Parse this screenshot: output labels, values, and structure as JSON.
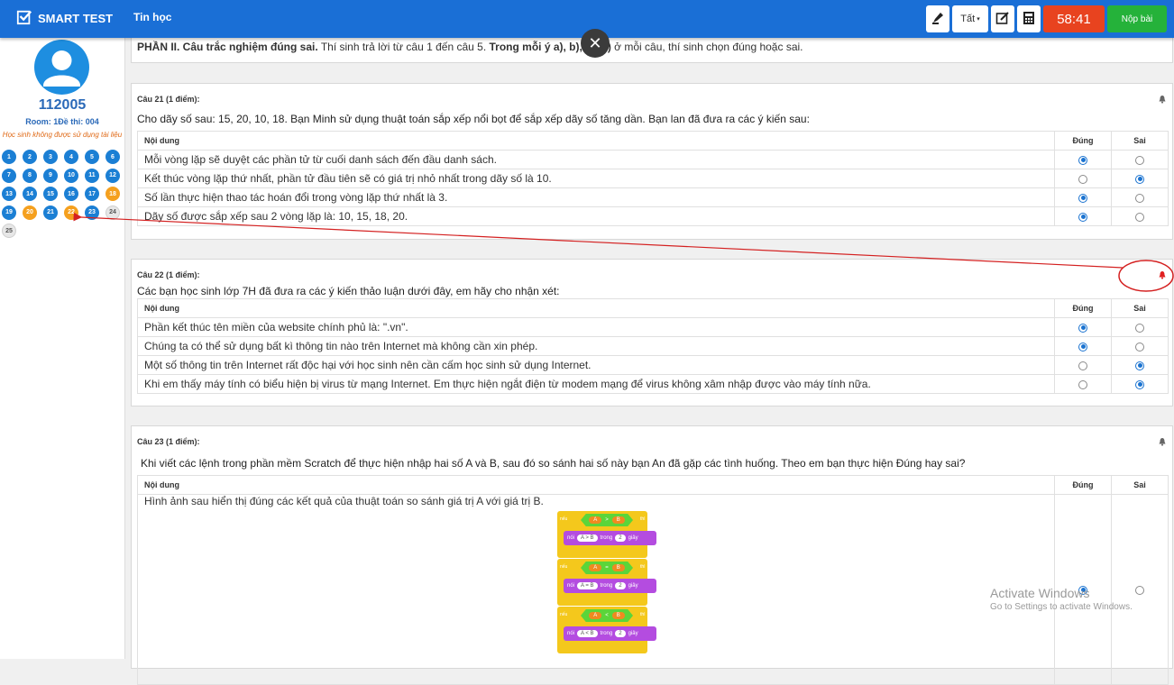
{
  "app": {
    "name": "SMART TEST",
    "subject": "Tin học"
  },
  "toolbar": {
    "filter_label": "Tất",
    "timer": "58:41",
    "submit_label": "Nộp bài"
  },
  "sidebar": {
    "student_id": "112005",
    "room": "Room: 1Đề thi: 004",
    "warning": "Học sinh không được sử dụng tài liệu",
    "questions": [
      {
        "n": "1",
        "s": "answered"
      },
      {
        "n": "2",
        "s": "answered"
      },
      {
        "n": "3",
        "s": "answered"
      },
      {
        "n": "4",
        "s": "answered"
      },
      {
        "n": "5",
        "s": "answered"
      },
      {
        "n": "6",
        "s": "answered"
      },
      {
        "n": "7",
        "s": "answered"
      },
      {
        "n": "8",
        "s": "answered"
      },
      {
        "n": "9",
        "s": "answered"
      },
      {
        "n": "10",
        "s": "answered"
      },
      {
        "n": "11",
        "s": "answered"
      },
      {
        "n": "12",
        "s": "answered"
      },
      {
        "n": "13",
        "s": "answered"
      },
      {
        "n": "14",
        "s": "answered"
      },
      {
        "n": "15",
        "s": "answered"
      },
      {
        "n": "16",
        "s": "answered"
      },
      {
        "n": "17",
        "s": "answered"
      },
      {
        "n": "18",
        "s": "flag"
      },
      {
        "n": "19",
        "s": "answered"
      },
      {
        "n": "20",
        "s": "flag"
      },
      {
        "n": "21",
        "s": "answered"
      },
      {
        "n": "22",
        "s": "flag"
      },
      {
        "n": "23",
        "s": "answered"
      },
      {
        "n": "24",
        "s": "empty"
      },
      {
        "n": "25",
        "s": "empty"
      }
    ]
  },
  "part": {
    "bold1": "PHẦN II. Câu trắc nghiệm đúng sai.",
    "text1": " Thí sinh trả lời từ câu 1 đến câu 5. ",
    "bold2": "Trong mỗi ý a), b), c), d)",
    "text2": " ở mỗi câu, thí sinh chọn đúng hoặc sai."
  },
  "headers": {
    "content": "Nội dung",
    "true": "Đúng",
    "false": "Sai"
  },
  "q21": {
    "title": "Câu 21 (1 điểm):",
    "text": "Cho dãy số sau: 15, 20, 10, 18. Bạn Minh sử dụng thuật toán sắp xếp nổi bọt để sắp xếp dãy số tăng dần. Bạn lan đã đưa ra các ý kiến sau:",
    "rows": [
      {
        "text": "Mỗi vòng lặp sẽ duyệt các phần tử từ cuối danh sách đến đầu danh sách.",
        "ans": "true"
      },
      {
        "text": "Kết thúc vòng lặp thứ nhất, phần tử đầu tiên sẽ có giá trị nhỏ nhất trong dãy số là 10.",
        "ans": "false"
      },
      {
        "text": "Số lần thực hiện thao tác hoán đổi trong vòng lặp thứ nhất là 3.",
        "ans": "true"
      },
      {
        "text": "Dãy số được sắp xếp sau 2 vòng lặp là: 10, 15, 18, 20.",
        "ans": "true"
      }
    ]
  },
  "q22": {
    "title": "Câu 22 (1 điểm):",
    "text": "Các bạn học sinh lớp 7H đã đưa ra các ý kiến thảo luận dưới đây, em hãy cho nhận xét:",
    "rows": [
      {
        "text": "Phần kết thúc tên miền của website chính phủ là: \".vn\".",
        "ans": "true"
      },
      {
        "text": "Chúng ta có thể sử dụng bất kì thông tin nào trên Internet mà không cần xin phép.",
        "ans": "true"
      },
      {
        "text": "Một số thông tin trên Internet rất độc hại với học sinh nên cần cấm học sinh sử dụng Internet.",
        "ans": "false"
      },
      {
        "text": "Khi em thấy máy tính có biểu hiện bị virus từ mạng Internet. Em thực hiện ngắt điện từ modem mạng để virus không xâm nhập được vào máy tính nữa.",
        "ans": "false"
      }
    ]
  },
  "q23": {
    "title": "Câu 23 (1 điểm):",
    "text": "Khi viết các lệnh trong phần mềm Scratch để thực hiện nhập hai số A và B, sau đó so sánh hai số này bạn An đã gặp các tình huống. Theo em bạn thực hiện Đúng hay sai?",
    "rows": [
      {
        "text": "Hình ảnh sau hiển thị đúng các kết quả của thuật toán so sánh giá trị A với giá trị B.",
        "ans": "true"
      }
    ],
    "blocks": {
      "if_label": "nếu",
      "then_label": "thì",
      "say_label": "nói",
      "for_label": "trong",
      "secs_label": "giây",
      "a": "A",
      "b": "B",
      "secs": "2",
      "items": [
        {
          "op": ">",
          "say": "A > B"
        },
        {
          "op": "=",
          "say": "A = B"
        },
        {
          "op": "<",
          "say": "A < B"
        }
      ]
    }
  },
  "watermark": {
    "line1": "Activate Windows",
    "line2": "Go to Settings to activate Windows."
  },
  "colors": {
    "topbar": "#1a6fd6",
    "timer": "#e8431f",
    "submit": "#25b23a",
    "answered": "#1b7fd4",
    "flagged": "#f5a01e",
    "annotation": "#d42020"
  }
}
